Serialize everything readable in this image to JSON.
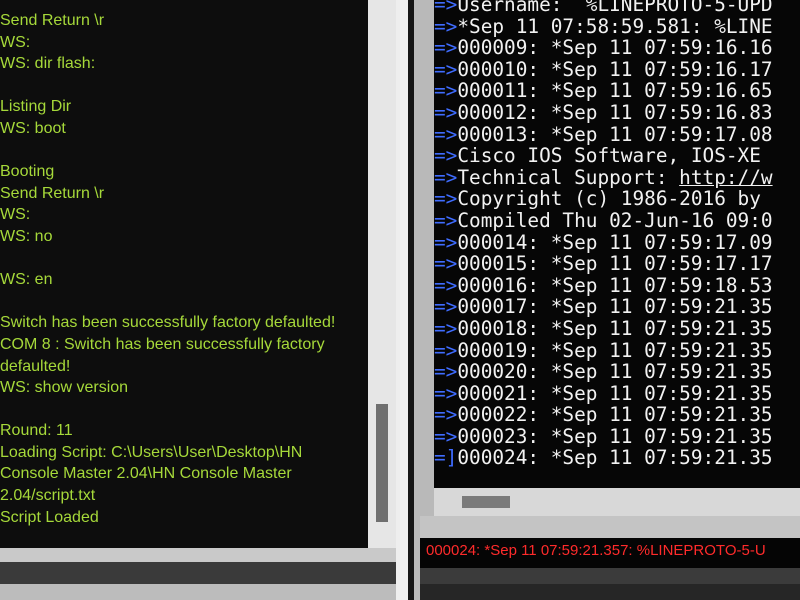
{
  "left_log": {
    "lines": [
      "Send Return \\r",
      "WS:",
      "WS: dir flash:",
      "",
      "Listing Dir",
      "WS: boot",
      "",
      "Booting",
      "Send Return \\r",
      "WS:",
      "WS: no",
      "",
      "WS: en",
      "",
      "Switch has been successfully factory defaulted!",
      "COM 8 : Switch has been successfully factory",
      "defaulted!",
      "WS: show version",
      "",
      "Round: 11",
      "Loading Script: C:\\Users\\User\\Desktop\\HN",
      "Console Master 2.04\\HN Console Master",
      "2.04/script.txt",
      "Script Loaded"
    ]
  },
  "console": {
    "prompt_symbol": "=>",
    "last_prompt_symbol": "=]",
    "lines": [
      {
        "text": "Username:  %LINEPROTO-5-UPD",
        "link": ""
      },
      {
        "text": "*Sep 11 07:58:59.581: %LINE",
        "link": ""
      },
      {
        "text": "000009: *Sep 11 07:59:16.16",
        "link": ""
      },
      {
        "text": "000010: *Sep 11 07:59:16.17",
        "link": ""
      },
      {
        "text": "000011: *Sep 11 07:59:16.65",
        "link": ""
      },
      {
        "text": "000012: *Sep 11 07:59:16.83",
        "link": ""
      },
      {
        "text": "000013: *Sep 11 07:59:17.08",
        "link": ""
      },
      {
        "text": "Cisco IOS Software, IOS-XE",
        "link": ""
      },
      {
        "text": "Technical Support: ",
        "link": "http://w"
      },
      {
        "text": "Copyright (c) 1986-2016 by",
        "link": ""
      },
      {
        "text": "Compiled Thu 02-Jun-16 09:0",
        "link": ""
      },
      {
        "text": "000014: *Sep 11 07:59:17.09",
        "link": ""
      },
      {
        "text": "000015: *Sep 11 07:59:17.17",
        "link": ""
      },
      {
        "text": "000016: *Sep 11 07:59:18.53",
        "link": ""
      },
      {
        "text": "000017: *Sep 11 07:59:21.35",
        "link": ""
      },
      {
        "text": "000018: *Sep 11 07:59:21.35",
        "link": ""
      },
      {
        "text": "000019: *Sep 11 07:59:21.35",
        "link": ""
      },
      {
        "text": "000020: *Sep 11 07:59:21.35",
        "link": ""
      },
      {
        "text": "000021: *Sep 11 07:59:21.35",
        "link": ""
      },
      {
        "text": "000022: *Sep 11 07:59:21.35",
        "link": ""
      },
      {
        "text": "000023: *Sep 11 07:59:21.35",
        "link": ""
      },
      {
        "text": "000024: *Sep 11 07:59:21.35",
        "link": ""
      }
    ]
  },
  "status_bar": {
    "text": "000024: *Sep 11 07:59:21.357: %LINEPROTO-5-U"
  },
  "colors": {
    "left_text": "#a6d93a",
    "prompt": "#3f6cff",
    "status_text": "#ff2b2b"
  }
}
